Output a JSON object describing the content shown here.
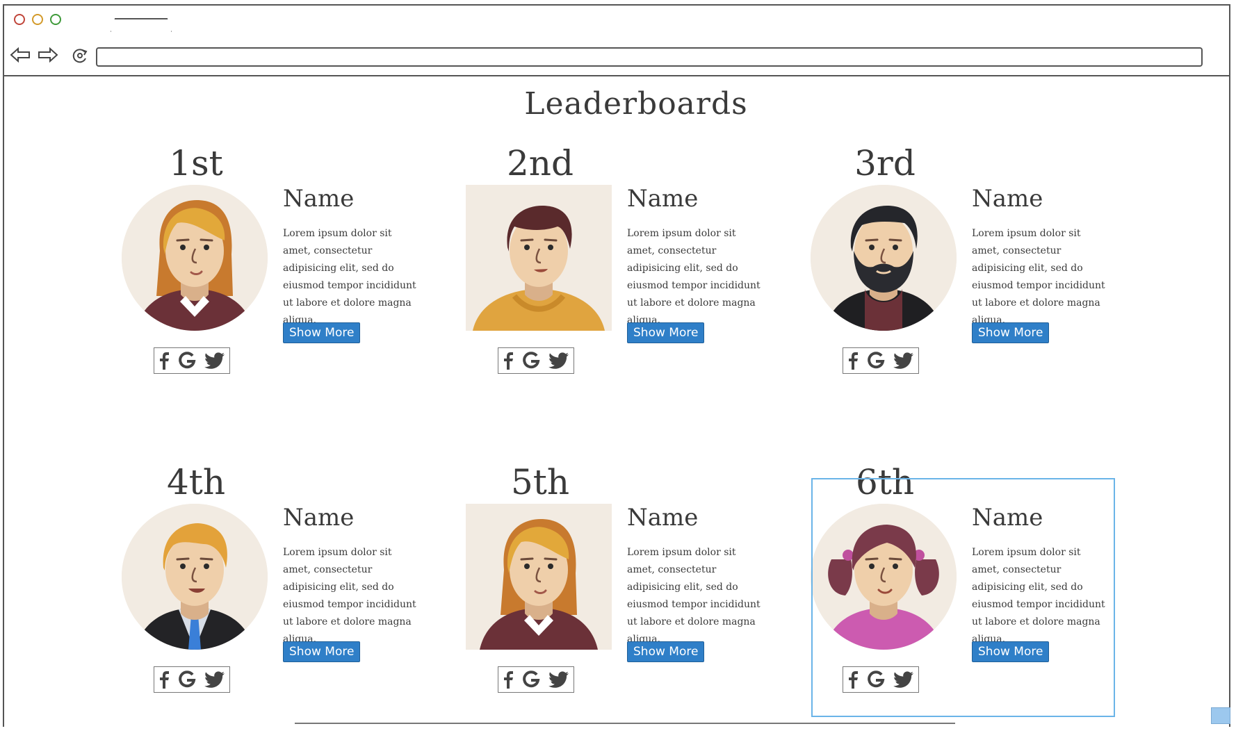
{
  "page": {
    "title": "Leaderboards"
  },
  "browser": {
    "url": ""
  },
  "leaderboard": [
    {
      "rank": "1st",
      "name": "Name",
      "description": "Lorem ipsum dolor sit amet, consectetur adipisicing elit, sed do eiusmod tempor incididunt ut labore et dolore magna aliqua.",
      "button": "Show More",
      "avatar": "woman-blonde-avatar-icon"
    },
    {
      "rank": "2nd",
      "name": "Name",
      "description": "Lorem ipsum dolor sit amet, consectetur adipisicing elit, sed do eiusmod tempor incididunt ut labore et dolore magna aliqua.",
      "button": "Show More",
      "avatar": "man-brown-hair-avatar-icon"
    },
    {
      "rank": "3rd",
      "name": "Name",
      "description": "Lorem ipsum dolor sit amet, consectetur adipisicing elit, sed do eiusmod tempor incididunt ut labore et dolore magna aliqua.",
      "button": "Show More",
      "avatar": "man-beard-avatar-icon"
    },
    {
      "rank": "4th",
      "name": "Name",
      "description": "Lorem ipsum dolor sit amet, consectetur adipisicing elit, sed do eiusmod tempor incididunt ut labore et dolore magna aliqua.",
      "button": "Show More",
      "avatar": "man-suit-avatar-icon"
    },
    {
      "rank": "5th",
      "name": "Name",
      "description": "Lorem ipsum dolor sit amet, consectetur adipisicing elit, sed do eiusmod tempor incididunt ut labore et dolore magna aliqua.",
      "button": "Show More",
      "avatar": "woman-blonde-avatar-icon"
    },
    {
      "rank": "6th",
      "name": "Name",
      "description": "Lorem ipsum dolor sit amet, consectetur adipisicing elit, sed do eiusmod tempor incididunt ut labore et dolore magna aliqua.",
      "button": "Show More",
      "avatar": "girl-pigtails-avatar-icon"
    }
  ],
  "social_icons": [
    "facebook-icon",
    "google-icon",
    "twitter-icon"
  ],
  "colors": {
    "button": "#2f7fc8",
    "selection": "#6ab4e8",
    "avatar_bg": "#f2ebe2"
  }
}
